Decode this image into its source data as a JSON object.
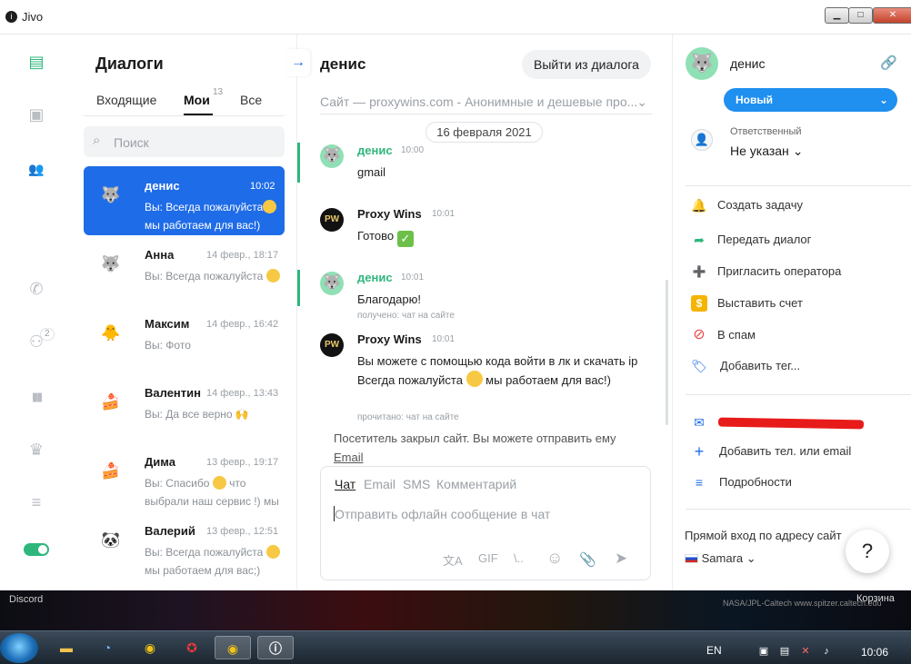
{
  "window": {
    "title": "Jivo",
    "logo": "i",
    "minimize": "▁",
    "maximize": "□",
    "close": "✕"
  },
  "nav": {
    "chat_icon": "▤",
    "monitor_icon": "▣",
    "team_icon": "👥",
    "phone_icon": "✆",
    "bots_icon": "⚇",
    "bots_badge": "2",
    "stats_icon": "▮▮",
    "crown_icon": "♛",
    "settings_icon": "≡",
    "accent": "#2fb67c"
  },
  "dialogs": {
    "title": "Диалоги",
    "tabs": [
      {
        "label": "Входящие"
      },
      {
        "label": "Мои"
      },
      {
        "label": "Все"
      }
    ],
    "mine_count": "13",
    "search_placeholder": "Поиск",
    "items": [
      {
        "avatar": "🐺",
        "name": "денис",
        "time": "10:02",
        "preview": "Вы: Всегда пожалуйста",
        "preview2": "мы работаем для вас!)"
      },
      {
        "avatar": "🐺",
        "name": "Анна",
        "time": "14 февр., 18:17",
        "preview": "Вы: Всегда пожалуйста"
      },
      {
        "avatar": "🐥",
        "name": "Максим",
        "time": "14 февр., 16:42",
        "preview": "Вы: Фото"
      },
      {
        "avatar": "🍰",
        "name": "Валентин",
        "time": "14 февр., 13:43",
        "preview": "Вы: Да все верно 🙌"
      },
      {
        "avatar": "🍰",
        "name": "Дима",
        "time": "13 февр., 19:17",
        "preview": "Вы: Спасибо",
        "preview_tail": "что",
        "preview2": "выбрали наш сервис !) мы"
      },
      {
        "avatar": "🐼",
        "name": "Валерий",
        "time": "13 февр., 12:51",
        "preview": "Вы: Всегда пожалуйста",
        "preview2": "мы работаем для вас;)"
      }
    ]
  },
  "chat": {
    "arrow": "→",
    "contact_name": "денис",
    "leave_button": "Выйти из диалога",
    "site": "Сайт — proxywins.com - Анонимные и дешевые про...",
    "date": "16 февраля 2021",
    "messages": [
      {
        "sender": "денис",
        "time": "10:00",
        "text": "gmail"
      },
      {
        "sender": "Proxy Wins",
        "time": "10:01",
        "text": "Готово",
        "check": "✓"
      },
      {
        "sender": "денис",
        "time": "10:01",
        "text": "Благодарю!",
        "meta": "получено: чат на сайте"
      },
      {
        "sender": "Proxy Wins",
        "time": "10:01",
        "text": "Вы можете с помощью кода войти в лк и скачать ip",
        "text2a": "Всегда пожалуйста",
        "text2b": "мы работаем для вас!)",
        "meta": "прочитано: чат на сайте"
      }
    ],
    "operator_avatar": "PW",
    "visitor_closed": "Посетитель закрыл сайт. Вы можете отправить ему",
    "email_link": "Email",
    "composer": {
      "tabs": [
        {
          "label": "Чат"
        },
        {
          "label": "Email"
        },
        {
          "label": "SMS"
        },
        {
          "label": "Комментарий"
        }
      ],
      "placeholder": "Отправить офлайн сообщение в чат",
      "tools": {
        "translate": "文A",
        "gif": "GIF",
        "script": "\\..",
        "emoji": "☺",
        "attach": "📎",
        "send": "➤"
      }
    }
  },
  "info": {
    "avatar": "🐺",
    "name": "денис",
    "link_icon": "🔗",
    "status": "Новый",
    "status_chevron": "⌄",
    "responsible_label": "Ответственный",
    "responsible_value": "Не указан",
    "actions": [
      {
        "icon": "🔔",
        "label": "Создать задачу",
        "color": "#f5b400"
      },
      {
        "icon": "➦",
        "label": "Передать диалог",
        "color": "#2fb67c"
      },
      {
        "icon": "➕",
        "label": "Пригласить оператора",
        "color": "#2fb67c"
      },
      {
        "icon": "$",
        "label": "Выставить счет",
        "color": "#f5b400"
      },
      {
        "icon": "⊘",
        "label": "В спам",
        "color": "#e84a4a"
      },
      {
        "icon": "🏷",
        "label": "Добавить тег...",
        "color": "#1f6ce8"
      }
    ],
    "contacts": [
      {
        "icon": "✉",
        "label": ""
      },
      {
        "icon": "+",
        "label": "Добавить тел. или email"
      },
      {
        "icon": "≡",
        "label": "Подробности"
      }
    ],
    "entry": "Прямой вход по адресу сайт",
    "region": "Samara",
    "help": "?"
  },
  "desktop": {
    "discord": "Discord",
    "credit": "NASA/JPL-Caltech   www.spitzer.caltech.edu",
    "trash": "Корзина"
  },
  "taskbar": {
    "lang": "EN",
    "clock": "10:06"
  }
}
